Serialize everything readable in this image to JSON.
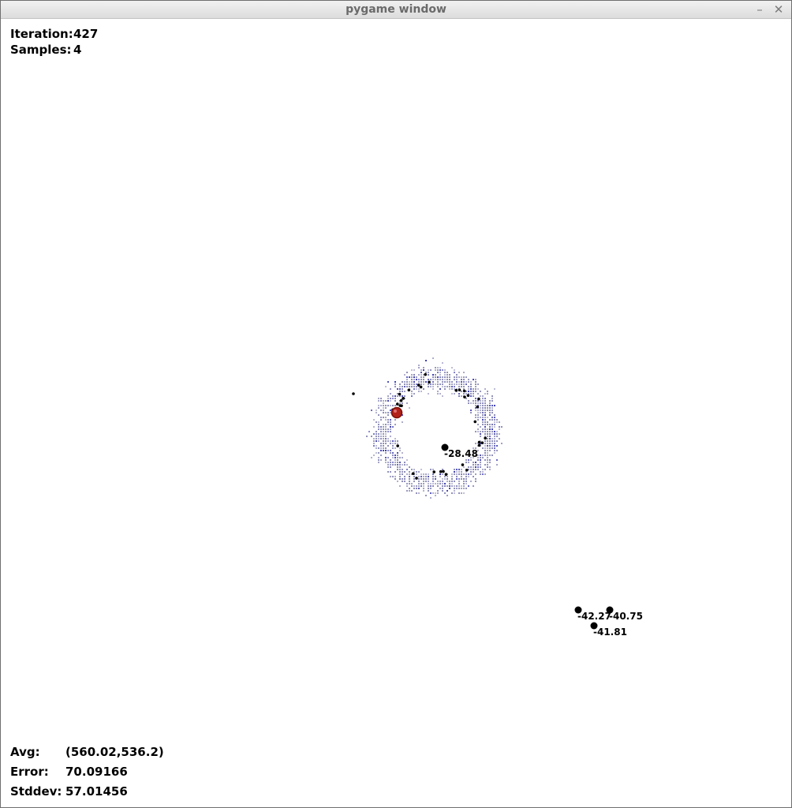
{
  "window": {
    "title": "pygame window",
    "minimize_glyph": "–",
    "close_glyph": "✕"
  },
  "hud_top": {
    "iteration_label": "Iteration:",
    "iteration_value": "427",
    "samples_label": "Samples:",
    "samples_value": "4"
  },
  "hud_bottom": {
    "avg_label": "Avg:",
    "avg_value": "(560.02,536.2)",
    "error_label": "Error:",
    "error_value": "70.09166",
    "stddev_label": "Stddev:",
    "stddev_value": "57.01456"
  },
  "samples": [
    {
      "label": "-28.48"
    },
    {
      "label": "-42.27"
    },
    {
      "label": "-40.75"
    },
    {
      "label": "-41.81"
    }
  ],
  "colors": {
    "particle": "#8f8fb8",
    "particle_dense": "#3d3db0",
    "sample_marker": "#000000",
    "robot": "#b3211b"
  }
}
